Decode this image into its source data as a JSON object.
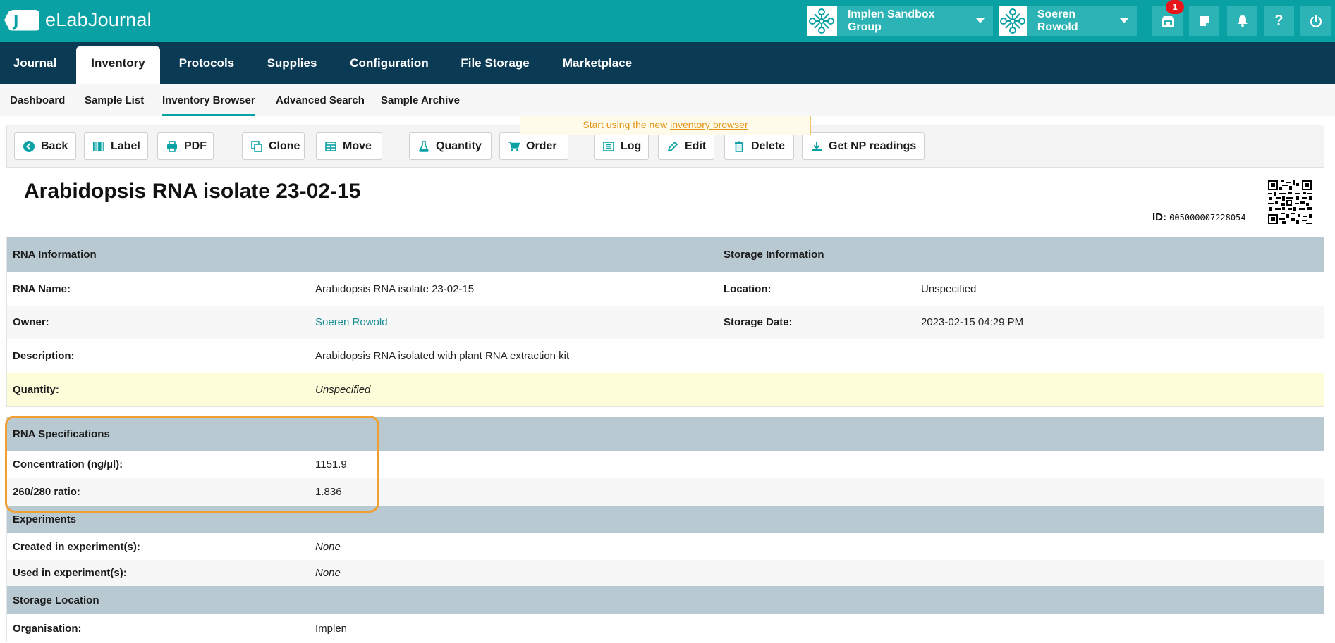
{
  "app": {
    "logo_badge": "J",
    "logo_text": "eLabJournal"
  },
  "topbar": {
    "group_name": "Implen Sandbox Group",
    "user_name": "Soeren Rowold",
    "notification_count": "1",
    "help_glyph": "?"
  },
  "main_nav": {
    "tabs": [
      {
        "label": "Journal"
      },
      {
        "label": "Inventory"
      },
      {
        "label": "Protocols"
      },
      {
        "label": "Supplies"
      },
      {
        "label": "Configuration"
      },
      {
        "label": "File Storage"
      },
      {
        "label": "Marketplace"
      }
    ],
    "active": "Inventory"
  },
  "sub_nav": {
    "tabs": [
      {
        "label": "Dashboard"
      },
      {
        "label": "Sample List"
      },
      {
        "label": "Inventory Browser"
      },
      {
        "label": "Advanced Search"
      },
      {
        "label": "Sample Archive"
      }
    ],
    "active": "Inventory Browser"
  },
  "banner": {
    "prefix": "Start using the new ",
    "link": "inventory browser"
  },
  "toolbar": {
    "back": "Back",
    "label": "Label",
    "pdf": "PDF",
    "clone": "Clone",
    "move": "Move",
    "quantity": "Quantity",
    "order": "Order",
    "log": "Log",
    "edit": "Edit",
    "delete": "Delete",
    "np_readings": "Get NP readings"
  },
  "sample": {
    "title": "Arabidopsis RNA isolate 23-02-15",
    "id_label": "ID:",
    "id_value": "005000007228054"
  },
  "rna_info": {
    "header": "RNA Information",
    "storage_header": "Storage Information",
    "name_label": "RNA Name:",
    "name_value": "Arabidopsis RNA isolate 23-02-15",
    "owner_label": "Owner:",
    "owner_value": "Soeren Rowold",
    "description_label": "Description:",
    "description_value": "Arabidopsis RNA isolated with plant RNA extraction kit",
    "quantity_label": "Quantity:",
    "quantity_value": "Unspecified",
    "location_label": "Location:",
    "location_value": "Unspecified",
    "storage_date_label": "Storage Date:",
    "storage_date_value": "2023-02-15 04:29 PM"
  },
  "rna_specs": {
    "header": "RNA Specifications",
    "concentration_label": "Concentration (ng/µl):",
    "concentration_value": "1151.9",
    "ratio_label": "260/280 ratio:",
    "ratio_value": "1.836"
  },
  "experiments": {
    "header": "Experiments",
    "created_label": "Created in experiment(s):",
    "created_value": "None",
    "used_label": "Used in experiment(s):",
    "used_value": "None"
  },
  "storage_location": {
    "header": "Storage Location",
    "org_label": "Organisation:",
    "org_value": "Implen"
  },
  "colors": {
    "accent": "#0aa1a5",
    "nav": "#0b3a55",
    "section_header": "#b9c9d2",
    "highlight": "#f0a031"
  }
}
